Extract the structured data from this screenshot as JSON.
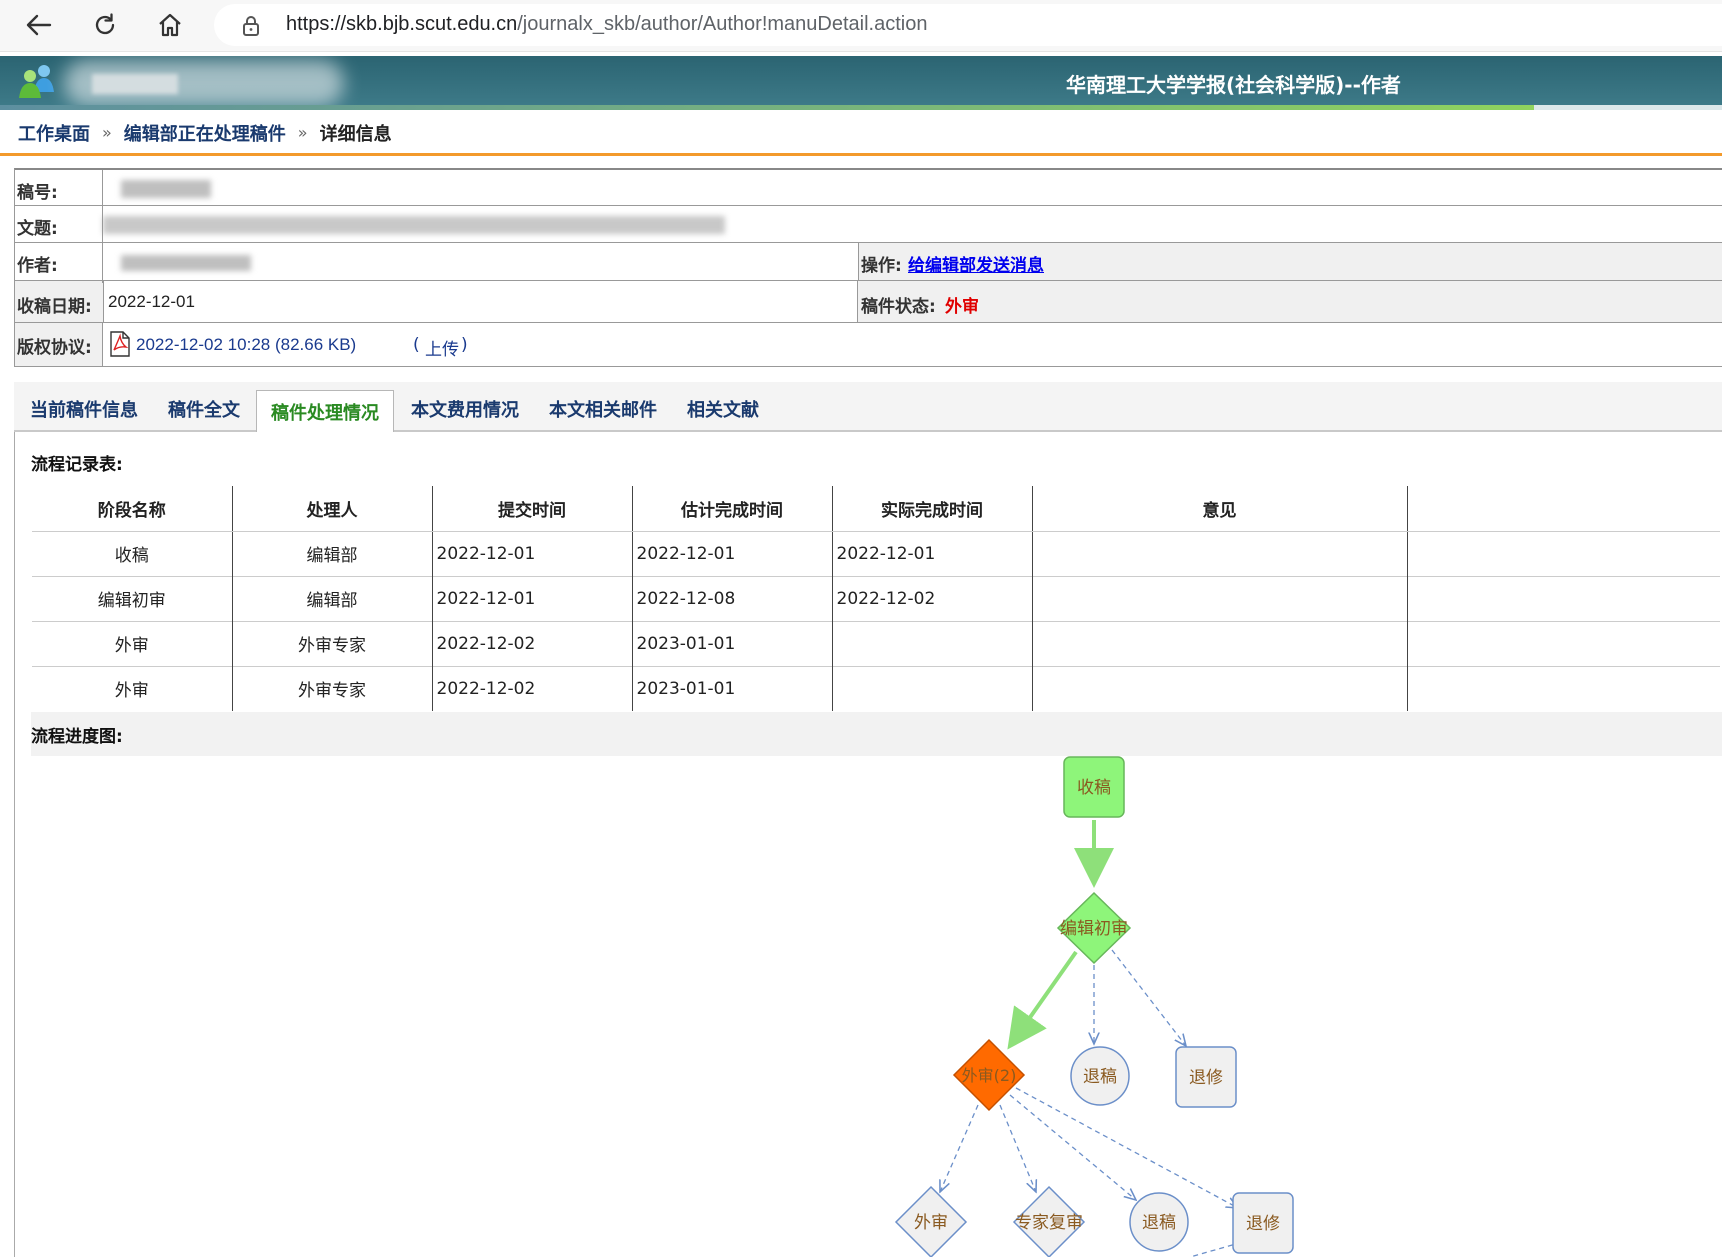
{
  "browser": {
    "url_host": "https://skb.bjb.scut.edu.cn",
    "url_path": "/journalx_skb/author/Author!manuDetail.action"
  },
  "header": {
    "title": "华南理工大学学报(社会科学版)--作者"
  },
  "breadcrumb": {
    "home": "工作桌面",
    "section": "编辑部正在处理稿件",
    "current": "详细信息",
    "sep": "»"
  },
  "info": {
    "manuscript_no_label": "稿号:",
    "title_label": "文题:",
    "author_label": "作者:",
    "operation_label": "操作:",
    "operation_link": "给编辑部发送消息",
    "received_label": "收稿日期:",
    "received_value": "2022-12-01",
    "status_label": "稿件状态:",
    "status_value": "外审",
    "copyright_label": "版权协议:",
    "copyright_file": "2022-12-02 10:28 (82.66 KB)",
    "upload_open": "(",
    "upload_link": "上传",
    "upload_close": ")"
  },
  "tabs": [
    "当前稿件信息",
    "稿件全文",
    "稿件处理情况",
    "本文费用情况",
    "本文相关邮件",
    "相关文献"
  ],
  "active_tab": "稿件处理情况",
  "flow_table": {
    "title": "流程记录表:",
    "headers": [
      "阶段名称",
      "处理人",
      "提交时间",
      "估计完成时间",
      "实际完成时间",
      "意见"
    ],
    "rows": [
      [
        "收稿",
        "编辑部",
        "2022-12-01",
        "2022-12-01",
        "2022-12-01",
        ""
      ],
      [
        "编辑初审",
        "编辑部",
        "2022-12-01",
        "2022-12-08",
        "2022-12-02",
        ""
      ],
      [
        "外审",
        "外审专家",
        "2022-12-02",
        "2023-01-01",
        "",
        ""
      ],
      [
        "外审",
        "外审专家",
        "2022-12-02",
        "2023-01-01",
        "",
        ""
      ]
    ]
  },
  "flow_chart": {
    "title": "流程进度图:",
    "nodes": {
      "receive": "收稿",
      "initial_review": "编辑初审",
      "external_review": "外审(2)",
      "reject_1": "退稿",
      "revise_1": "退修",
      "external_review_next": "外审",
      "expert_rereview": "专家复审",
      "reject_2": "退稿",
      "revise_2": "退修"
    },
    "colors": {
      "done": "#8ef57a",
      "current": "#ff6a00",
      "pending": "#f0f0f0",
      "pending_border": "#6b8fc9",
      "done_arrow": "#8ee07a",
      "label_text": "#8a5a20"
    }
  }
}
